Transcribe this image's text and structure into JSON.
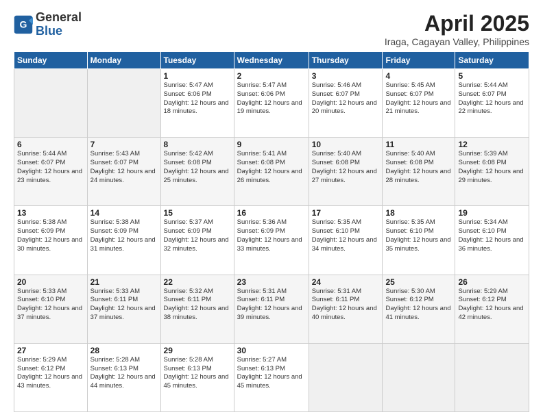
{
  "header": {
    "logo_general": "General",
    "logo_blue": "Blue",
    "month_title": "April 2025",
    "location": "Iraga, Cagayan Valley, Philippines"
  },
  "weekdays": [
    "Sunday",
    "Monday",
    "Tuesday",
    "Wednesday",
    "Thursday",
    "Friday",
    "Saturday"
  ],
  "weeks": [
    [
      {
        "day": "",
        "info": ""
      },
      {
        "day": "",
        "info": ""
      },
      {
        "day": "1",
        "info": "Sunrise: 5:47 AM\nSunset: 6:06 PM\nDaylight: 12 hours and 18 minutes."
      },
      {
        "day": "2",
        "info": "Sunrise: 5:47 AM\nSunset: 6:06 PM\nDaylight: 12 hours and 19 minutes."
      },
      {
        "day": "3",
        "info": "Sunrise: 5:46 AM\nSunset: 6:07 PM\nDaylight: 12 hours and 20 minutes."
      },
      {
        "day": "4",
        "info": "Sunrise: 5:45 AM\nSunset: 6:07 PM\nDaylight: 12 hours and 21 minutes."
      },
      {
        "day": "5",
        "info": "Sunrise: 5:44 AM\nSunset: 6:07 PM\nDaylight: 12 hours and 22 minutes."
      }
    ],
    [
      {
        "day": "6",
        "info": "Sunrise: 5:44 AM\nSunset: 6:07 PM\nDaylight: 12 hours and 23 minutes."
      },
      {
        "day": "7",
        "info": "Sunrise: 5:43 AM\nSunset: 6:07 PM\nDaylight: 12 hours and 24 minutes."
      },
      {
        "day": "8",
        "info": "Sunrise: 5:42 AM\nSunset: 6:08 PM\nDaylight: 12 hours and 25 minutes."
      },
      {
        "day": "9",
        "info": "Sunrise: 5:41 AM\nSunset: 6:08 PM\nDaylight: 12 hours and 26 minutes."
      },
      {
        "day": "10",
        "info": "Sunrise: 5:40 AM\nSunset: 6:08 PM\nDaylight: 12 hours and 27 minutes."
      },
      {
        "day": "11",
        "info": "Sunrise: 5:40 AM\nSunset: 6:08 PM\nDaylight: 12 hours and 28 minutes."
      },
      {
        "day": "12",
        "info": "Sunrise: 5:39 AM\nSunset: 6:08 PM\nDaylight: 12 hours and 29 minutes."
      }
    ],
    [
      {
        "day": "13",
        "info": "Sunrise: 5:38 AM\nSunset: 6:09 PM\nDaylight: 12 hours and 30 minutes."
      },
      {
        "day": "14",
        "info": "Sunrise: 5:38 AM\nSunset: 6:09 PM\nDaylight: 12 hours and 31 minutes."
      },
      {
        "day": "15",
        "info": "Sunrise: 5:37 AM\nSunset: 6:09 PM\nDaylight: 12 hours and 32 minutes."
      },
      {
        "day": "16",
        "info": "Sunrise: 5:36 AM\nSunset: 6:09 PM\nDaylight: 12 hours and 33 minutes."
      },
      {
        "day": "17",
        "info": "Sunrise: 5:35 AM\nSunset: 6:10 PM\nDaylight: 12 hours and 34 minutes."
      },
      {
        "day": "18",
        "info": "Sunrise: 5:35 AM\nSunset: 6:10 PM\nDaylight: 12 hours and 35 minutes."
      },
      {
        "day": "19",
        "info": "Sunrise: 5:34 AM\nSunset: 6:10 PM\nDaylight: 12 hours and 36 minutes."
      }
    ],
    [
      {
        "day": "20",
        "info": "Sunrise: 5:33 AM\nSunset: 6:10 PM\nDaylight: 12 hours and 37 minutes."
      },
      {
        "day": "21",
        "info": "Sunrise: 5:33 AM\nSunset: 6:11 PM\nDaylight: 12 hours and 37 minutes."
      },
      {
        "day": "22",
        "info": "Sunrise: 5:32 AM\nSunset: 6:11 PM\nDaylight: 12 hours and 38 minutes."
      },
      {
        "day": "23",
        "info": "Sunrise: 5:31 AM\nSunset: 6:11 PM\nDaylight: 12 hours and 39 minutes."
      },
      {
        "day": "24",
        "info": "Sunrise: 5:31 AM\nSunset: 6:11 PM\nDaylight: 12 hours and 40 minutes."
      },
      {
        "day": "25",
        "info": "Sunrise: 5:30 AM\nSunset: 6:12 PM\nDaylight: 12 hours and 41 minutes."
      },
      {
        "day": "26",
        "info": "Sunrise: 5:29 AM\nSunset: 6:12 PM\nDaylight: 12 hours and 42 minutes."
      }
    ],
    [
      {
        "day": "27",
        "info": "Sunrise: 5:29 AM\nSunset: 6:12 PM\nDaylight: 12 hours and 43 minutes."
      },
      {
        "day": "28",
        "info": "Sunrise: 5:28 AM\nSunset: 6:13 PM\nDaylight: 12 hours and 44 minutes."
      },
      {
        "day": "29",
        "info": "Sunrise: 5:28 AM\nSunset: 6:13 PM\nDaylight: 12 hours and 45 minutes."
      },
      {
        "day": "30",
        "info": "Sunrise: 5:27 AM\nSunset: 6:13 PM\nDaylight: 12 hours and 45 minutes."
      },
      {
        "day": "",
        "info": ""
      },
      {
        "day": "",
        "info": ""
      },
      {
        "day": "",
        "info": ""
      }
    ]
  ]
}
